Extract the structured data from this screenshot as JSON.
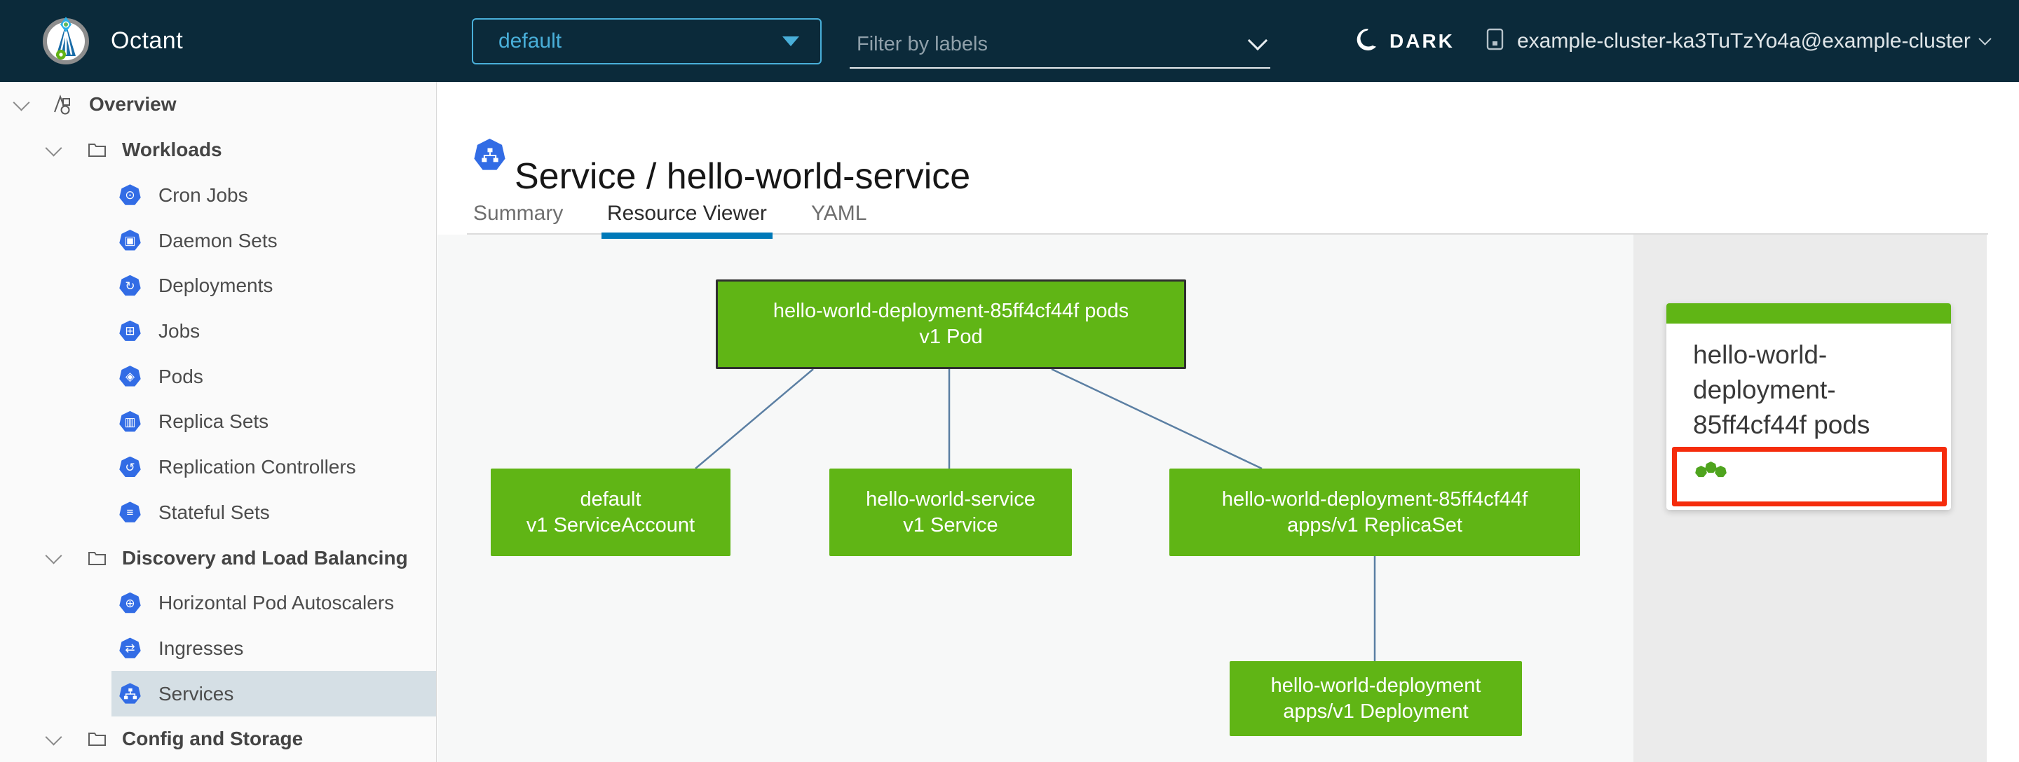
{
  "colors": {
    "header_bg": "#0b2a3a",
    "accent_blue": "#49afd9",
    "k8s_icon_blue": "#326ce5",
    "node_green": "#60b515",
    "pod_status_green": "#4fa41e",
    "alert_red": "#f52c0c",
    "active_tab_blue": "#0079b8",
    "edge_blue": "#5b7fa3",
    "selected_row_bg": "#d5dfe5"
  },
  "header": {
    "app_name": "Octant",
    "namespace": "default",
    "filter_placeholder": "Filter by labels",
    "theme_label": "DARK",
    "cluster_label": "example-cluster-ka3TuTzYo4a@example-cluster"
  },
  "sidebar": {
    "items": [
      {
        "label": "Overview",
        "level": 0,
        "expandable": true
      },
      {
        "label": "Workloads",
        "level": 1,
        "expandable": true
      },
      {
        "label": "Cron Jobs",
        "level": 2
      },
      {
        "label": "Daemon Sets",
        "level": 2
      },
      {
        "label": "Deployments",
        "level": 2
      },
      {
        "label": "Jobs",
        "level": 2
      },
      {
        "label": "Pods",
        "level": 2
      },
      {
        "label": "Replica Sets",
        "level": 2
      },
      {
        "label": "Replication Controllers",
        "level": 2
      },
      {
        "label": "Stateful Sets",
        "level": 2
      },
      {
        "label": "Discovery and Load Balancing",
        "level": 1,
        "expandable": true
      },
      {
        "label": "Horizontal Pod Autoscalers",
        "level": 2
      },
      {
        "label": "Ingresses",
        "level": 2
      },
      {
        "label": "Services",
        "level": 2,
        "selected": true
      },
      {
        "label": "Config and Storage",
        "level": 1,
        "expandable": true
      }
    ]
  },
  "icons": {
    "cronjob": "⊙",
    "daemonset": "▣",
    "deployment": "↻",
    "job": "⊞",
    "pod": "◈",
    "replicaset": "▥",
    "replicationcontroller": "↺",
    "statefulset": "≡",
    "hpa": "⊕",
    "ingress": "⇄"
  },
  "main": {
    "title": "Service / hello-world-service",
    "tabs": [
      {
        "label": "Summary",
        "active": false
      },
      {
        "label": "Resource Viewer",
        "active": true
      },
      {
        "label": "YAML",
        "active": false
      }
    ],
    "graph": {
      "nodes": [
        {
          "id": "pod",
          "name": "hello-world-deployment-85ff4cf44f pods",
          "kind": "v1 Pod",
          "status": "ok",
          "selected": true
        },
        {
          "id": "serviceaccount",
          "name": "default",
          "kind": "v1 ServiceAccount",
          "status": "ok"
        },
        {
          "id": "service",
          "name": "hello-world-service",
          "kind": "v1 Service",
          "status": "ok"
        },
        {
          "id": "replicaset",
          "name": "hello-world-deployment-85ff4cf44f",
          "kind": "apps/v1 ReplicaSet",
          "status": "ok"
        },
        {
          "id": "deployment",
          "name": "hello-world-deployment",
          "kind": "apps/v1 Deployment",
          "status": "ok"
        }
      ],
      "edges": [
        [
          "pod",
          "serviceaccount"
        ],
        [
          "pod",
          "service"
        ],
        [
          "pod",
          "replicaset"
        ],
        [
          "replicaset",
          "deployment"
        ]
      ]
    },
    "detail_panel": {
      "title": "hello-world-deployment-85ff4cf44f pods",
      "pod_count": 3
    }
  }
}
